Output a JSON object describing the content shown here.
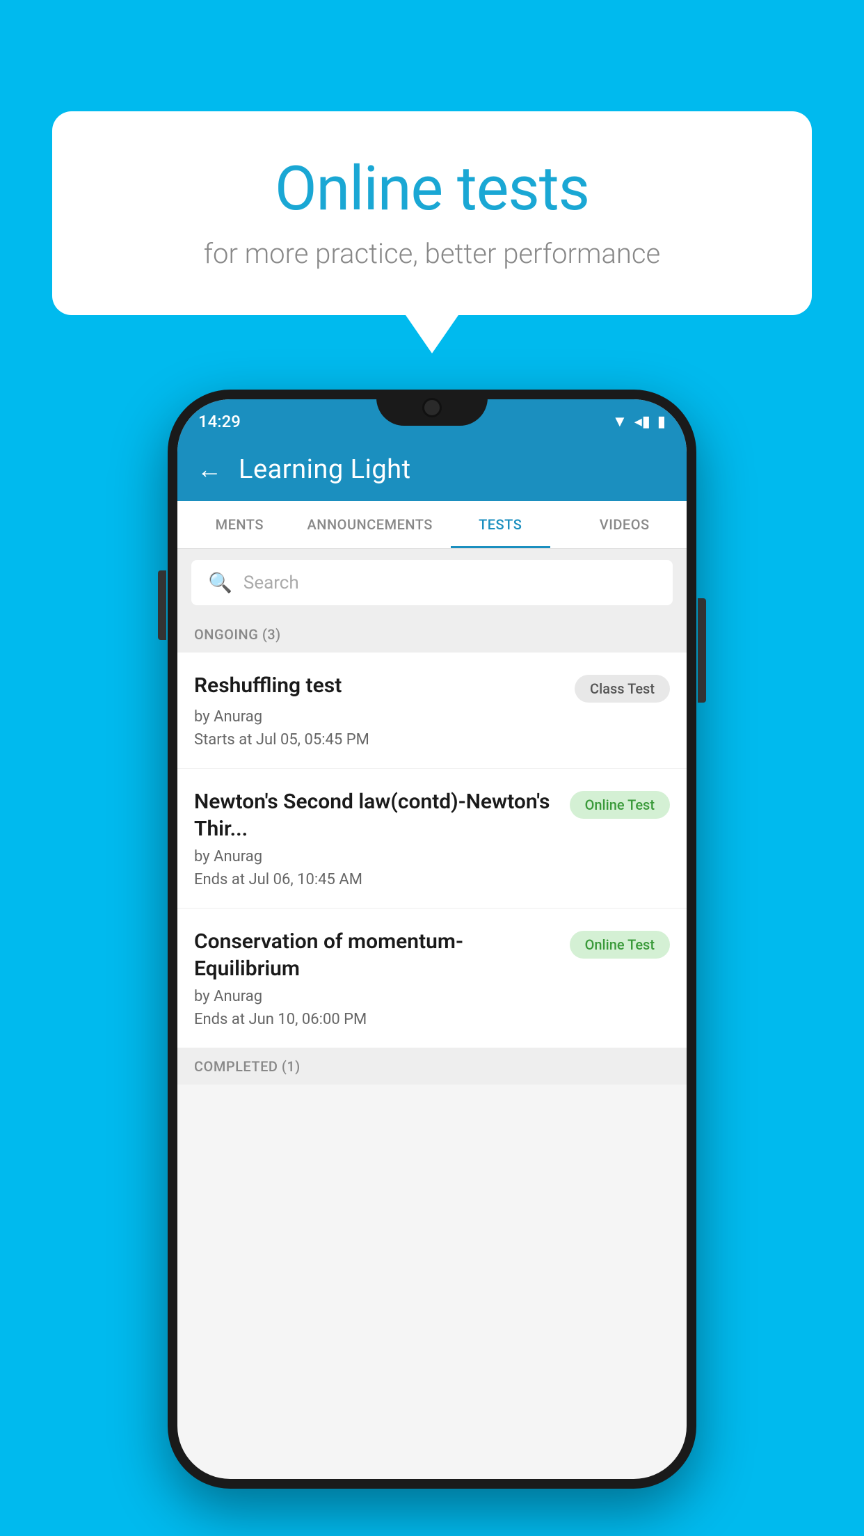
{
  "background_color": "#00BAEE",
  "bubble": {
    "title": "Online tests",
    "subtitle": "for more practice, better performance"
  },
  "phone": {
    "status_bar": {
      "time": "14:29",
      "icons": [
        "wifi",
        "signal",
        "battery"
      ]
    },
    "header": {
      "title": "Learning Light",
      "back_label": "←"
    },
    "tabs": [
      {
        "label": "MENTS",
        "active": false
      },
      {
        "label": "ANNOUNCEMENTS",
        "active": false
      },
      {
        "label": "TESTS",
        "active": true
      },
      {
        "label": "VIDEOS",
        "active": false
      }
    ],
    "search": {
      "placeholder": "Search"
    },
    "ongoing_section": {
      "label": "ONGOING (3)",
      "tests": [
        {
          "name": "Reshuffling test",
          "badge": "Class Test",
          "badge_type": "class",
          "author": "by Anurag",
          "time_label": "Starts at",
          "time": "Jul 05, 05:45 PM"
        },
        {
          "name": "Newton's Second law(contd)-Newton's Thir...",
          "badge": "Online Test",
          "badge_type": "online",
          "author": "by Anurag",
          "time_label": "Ends at",
          "time": "Jul 06, 10:45 AM"
        },
        {
          "name": "Conservation of momentum-Equilibrium",
          "badge": "Online Test",
          "badge_type": "online",
          "author": "by Anurag",
          "time_label": "Ends at",
          "time": "Jun 10, 06:00 PM"
        }
      ]
    },
    "completed_section": {
      "label": "COMPLETED (1)"
    }
  }
}
